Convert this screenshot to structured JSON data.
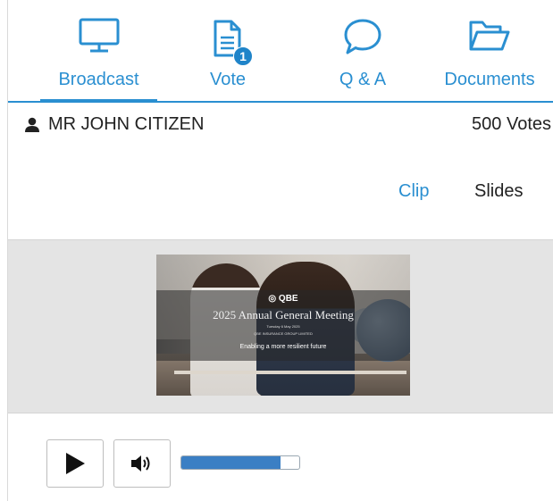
{
  "tabs": [
    {
      "label": "Broadcast",
      "icon": "monitor-icon",
      "active": true
    },
    {
      "label": "Vote",
      "icon": "document-icon",
      "badge": "1"
    },
    {
      "label": "Q & A",
      "icon": "speech-bubble-icon"
    },
    {
      "label": "Documents",
      "icon": "folder-open-icon"
    }
  ],
  "user": {
    "name": "MR JOHN CITIZEN",
    "votes": "500 Votes",
    "icon": "person-icon"
  },
  "view_toggle": {
    "clip": "Clip",
    "slides": "Slides"
  },
  "video": {
    "logo": "◎ QBE",
    "title": "2025 Annual General Meeting",
    "date_line": "Tuesday 6 May 2025",
    "company_line": "QBE INSURANCE GROUP LIMITED",
    "tagline": "Enabling a more resilient future"
  },
  "player": {
    "play_icon": "play-icon",
    "volume_icon": "volume-icon",
    "volume_level": 0.84
  },
  "colors": {
    "accent": "#2a8fd1",
    "progress": "#3b7fc4",
    "stage_bg": "#e4e4e4"
  }
}
